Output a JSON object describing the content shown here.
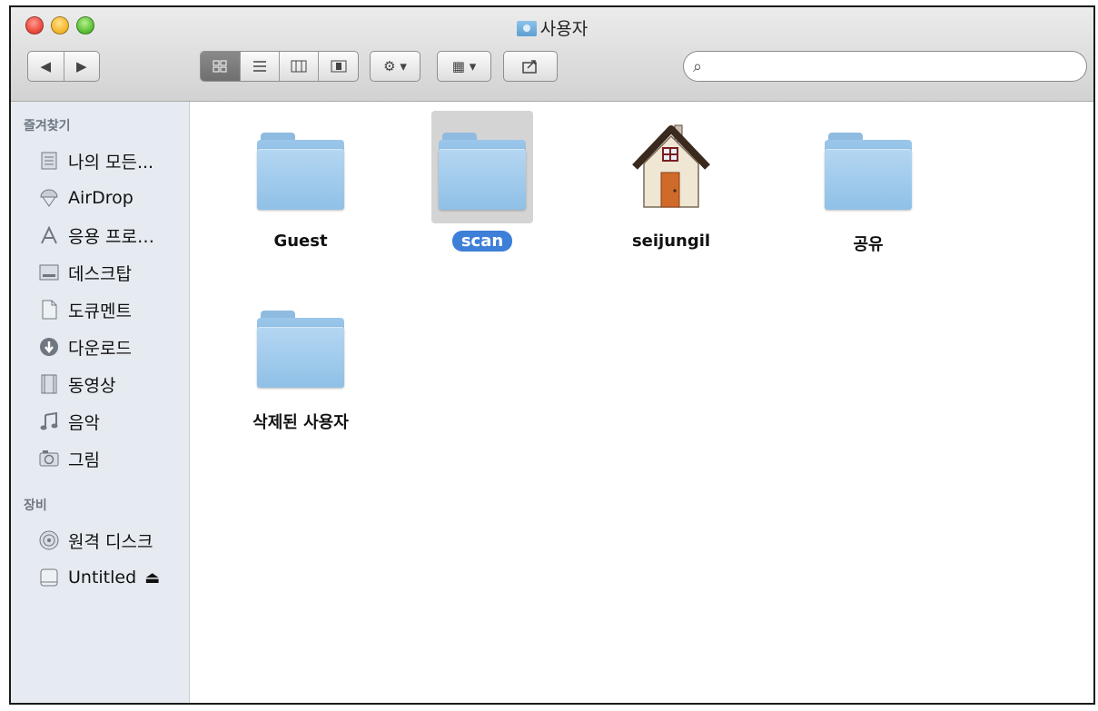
{
  "window": {
    "title": "사용자"
  },
  "toolbar": {
    "nav": {
      "back_icon": "◀",
      "forward_icon": "▶"
    },
    "view_buttons": [
      "icon-view",
      "list-view",
      "column-view",
      "coverflow-view"
    ],
    "action_icon": "⚙ ▾",
    "arrange_icon": "▦ ▾",
    "share_icon": "↗",
    "search": {
      "value": "",
      "icon": "⌕"
    }
  },
  "sidebar": {
    "favorites_title": "즐겨찾기",
    "favorites": [
      {
        "label": "나의 모든...",
        "icon": "all-files-icon"
      },
      {
        "label": "AirDrop",
        "icon": "airdrop-icon"
      },
      {
        "label": "응용 프로…",
        "icon": "applications-icon"
      },
      {
        "label": "데스크탑",
        "icon": "desktop-icon"
      },
      {
        "label": "도큐멘트",
        "icon": "documents-icon"
      },
      {
        "label": "다운로드",
        "icon": "downloads-icon"
      },
      {
        "label": "동영상",
        "icon": "movies-icon"
      },
      {
        "label": "음악",
        "icon": "music-icon"
      },
      {
        "label": "그림",
        "icon": "pictures-icon"
      }
    ],
    "devices_title": "장비",
    "devices": [
      {
        "label": "원격 디스크",
        "icon": "remote-disc-icon"
      },
      {
        "label": "Untitled",
        "icon": "drive-icon",
        "eject": "⏏"
      }
    ]
  },
  "files": [
    {
      "name": "Guest",
      "type": "folder",
      "selected": false
    },
    {
      "name": "scan",
      "type": "folder",
      "selected": true
    },
    {
      "name": "seijungil",
      "type": "home",
      "selected": false
    },
    {
      "name": "공유",
      "type": "folder",
      "selected": false
    },
    {
      "name": "삭제된 사용자",
      "type": "folder",
      "selected": false
    }
  ]
}
